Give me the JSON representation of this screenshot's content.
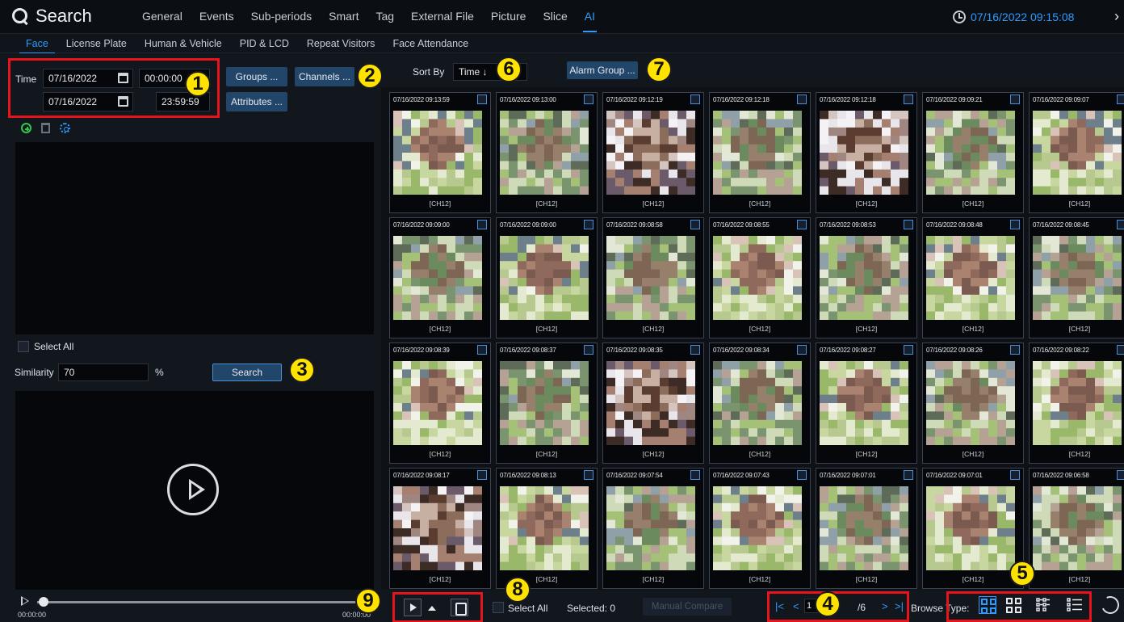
{
  "app": {
    "title": "Search"
  },
  "main_tabs": [
    {
      "label": "General"
    },
    {
      "label": "Events"
    },
    {
      "label": "Sub-periods"
    },
    {
      "label": "Smart"
    },
    {
      "label": "Tag"
    },
    {
      "label": "External File"
    },
    {
      "label": "Picture"
    },
    {
      "label": "Slice"
    },
    {
      "label": "AI"
    }
  ],
  "clock": "07/16/2022 09:15:08",
  "sub_tabs": [
    {
      "label": "Face"
    },
    {
      "label": "License Plate"
    },
    {
      "label": "Human & Vehicle"
    },
    {
      "label": "PID & LCD"
    },
    {
      "label": "Repeat Visitors"
    },
    {
      "label": "Face Attendance"
    }
  ],
  "time_filter": {
    "label": "Time",
    "start_date": "07/16/2022",
    "start_time": "00:00:00",
    "end_date": "07/16/2022",
    "end_time": "23:59:59"
  },
  "buttons": {
    "groups": "Groups ...",
    "channels": "Channels ...",
    "attributes": "Attributes ...",
    "search": "Search",
    "alarm_group": "Alarm Group ...",
    "manual_compare": "Manual Compare"
  },
  "select_all": "Select All",
  "similarity": {
    "label": "Similarity",
    "value": "70",
    "unit": "%"
  },
  "sort": {
    "label": "Sort By",
    "value": "Time ↓"
  },
  "playback": {
    "start": "00:00:00",
    "end": "00:00:00"
  },
  "callouts": [
    "1",
    "2",
    "3",
    "4",
    "5",
    "6",
    "7",
    "8",
    "9"
  ],
  "results": [
    {
      "ts": "07/16/2022 09:13:59",
      "ch": "[CH12]"
    },
    {
      "ts": "07/16/2022 09:13:00",
      "ch": "[CH12]"
    },
    {
      "ts": "07/16/2022 09:12:19",
      "ch": "[CH12]"
    },
    {
      "ts": "07/16/2022 09:12:18",
      "ch": "[CH12]"
    },
    {
      "ts": "07/16/2022 09:12:18",
      "ch": "[CH12]"
    },
    {
      "ts": "07/16/2022 09:09:21",
      "ch": "[CH12]"
    },
    {
      "ts": "07/16/2022 09:09:07",
      "ch": "[CH12]"
    },
    {
      "ts": "07/16/2022 09:09:00",
      "ch": "[CH12]"
    },
    {
      "ts": "07/16/2022 09:09:00",
      "ch": "[CH12]"
    },
    {
      "ts": "07/16/2022 09:08:58",
      "ch": "[CH12]"
    },
    {
      "ts": "07/16/2022 09:08:55",
      "ch": "[CH12]"
    },
    {
      "ts": "07/16/2022 09:08:53",
      "ch": "[CH12]"
    },
    {
      "ts": "07/16/2022 09:08:48",
      "ch": "[CH12]"
    },
    {
      "ts": "07/16/2022 09:08:45",
      "ch": "[CH12]"
    },
    {
      "ts": "07/16/2022 09:08:39",
      "ch": "[CH12]"
    },
    {
      "ts": "07/16/2022 09:08:37",
      "ch": "[CH12]"
    },
    {
      "ts": "07/16/2022 09:08:35",
      "ch": "[CH12]"
    },
    {
      "ts": "07/16/2022 09:08:34",
      "ch": "[CH12]"
    },
    {
      "ts": "07/16/2022 09:08:27",
      "ch": "[CH12]"
    },
    {
      "ts": "07/16/2022 09:08:26",
      "ch": "[CH12]"
    },
    {
      "ts": "07/16/2022 09:08:22",
      "ch": "[CH12]"
    },
    {
      "ts": "07/16/2022 09:08:17",
      "ch": "[CH12]"
    },
    {
      "ts": "07/16/2022 09:08:13",
      "ch": "[CH12]"
    },
    {
      "ts": "07/16/2022 09:07:54",
      "ch": "[CH12]"
    },
    {
      "ts": "07/16/2022 09:07:43",
      "ch": "[CH12]"
    },
    {
      "ts": "07/16/2022 09:07:01",
      "ch": "[CH12]"
    },
    {
      "ts": "07/16/2022 09:07:01",
      "ch": "[CH12]"
    },
    {
      "ts": "07/16/2022 09:06:58",
      "ch": "[CH12]"
    }
  ],
  "bottom": {
    "select_all": "Select All",
    "selected": "Selected: 0"
  },
  "pager": {
    "current": "1",
    "total": "/6"
  },
  "browse_type": "Browse Type:",
  "colors": {
    "accent": "#2e9bff",
    "highlight": "#e8141c",
    "callout": "#ffe300"
  }
}
